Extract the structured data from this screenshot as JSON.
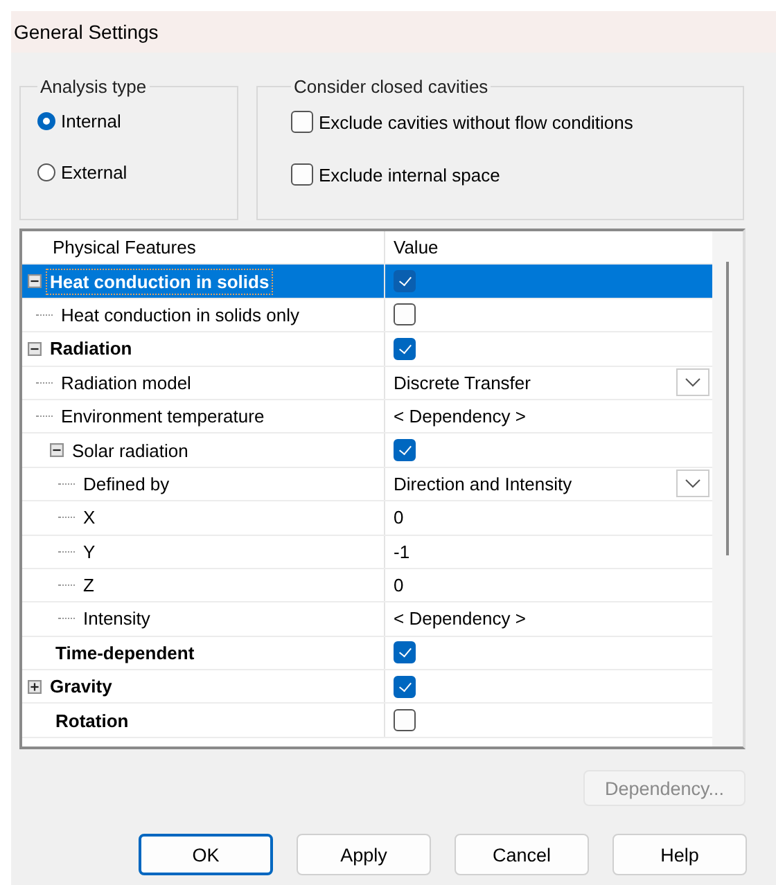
{
  "window": {
    "title": "General Settings"
  },
  "analysis_type": {
    "label": "Analysis type",
    "options": [
      {
        "label": "Internal",
        "selected": true
      },
      {
        "label": "External",
        "selected": false
      }
    ]
  },
  "closed_cavities": {
    "label": "Consider closed cavities",
    "options": [
      {
        "label": "Exclude cavities without flow conditions",
        "checked": false
      },
      {
        "label": "Exclude internal space",
        "checked": false
      }
    ]
  },
  "features": {
    "columns": [
      "Physical Features",
      "Value"
    ],
    "rows": [
      {
        "label": "Heat conduction in solids",
        "selected": true,
        "expanded": true,
        "kind": "checkbox",
        "checked": true,
        "children": [
          {
            "label": "Heat conduction in solids only",
            "selected": false,
            "kind": "checkbox",
            "checked": false
          }
        ]
      },
      {
        "label": "Radiation",
        "selected": false,
        "expanded": true,
        "kind": "checkbox",
        "checked": true,
        "children": [
          {
            "label": "Radiation model",
            "selected": false,
            "kind": "dropdown",
            "value": "Discrete Transfer"
          },
          {
            "label": "Environment temperature",
            "selected": false,
            "kind": "text",
            "value": "< Dependency >"
          },
          {
            "label": "Solar radiation",
            "selected": false,
            "expanded": true,
            "kind": "checkbox",
            "checked": true,
            "children": [
              {
                "label": "Defined by",
                "selected": false,
                "kind": "dropdown",
                "value": "Direction and Intensity"
              },
              {
                "label": "X",
                "selected": false,
                "kind": "text",
                "value": "0"
              },
              {
                "label": "Y",
                "selected": false,
                "kind": "text",
                "value": "-1"
              },
              {
                "label": "Z",
                "selected": false,
                "kind": "text",
                "value": "0"
              },
              {
                "label": "Intensity",
                "selected": false,
                "kind": "text",
                "value": "< Dependency >"
              }
            ]
          }
        ]
      },
      {
        "label": "Time-dependent",
        "selected": false,
        "kind": "checkbox",
        "checked": true
      },
      {
        "label": "Gravity",
        "selected": false,
        "expanded": false,
        "kind": "checkbox",
        "checked": true
      },
      {
        "label": "Rotation",
        "selected": false,
        "kind": "checkbox",
        "checked": false
      }
    ]
  },
  "dependency_button": {
    "label": "Dependency...",
    "disabled": true
  },
  "buttons": [
    {
      "label": "OK",
      "default": true
    },
    {
      "label": "Apply",
      "default": false
    },
    {
      "label": "Cancel",
      "default": false
    },
    {
      "label": "Help",
      "default": false
    }
  ]
}
